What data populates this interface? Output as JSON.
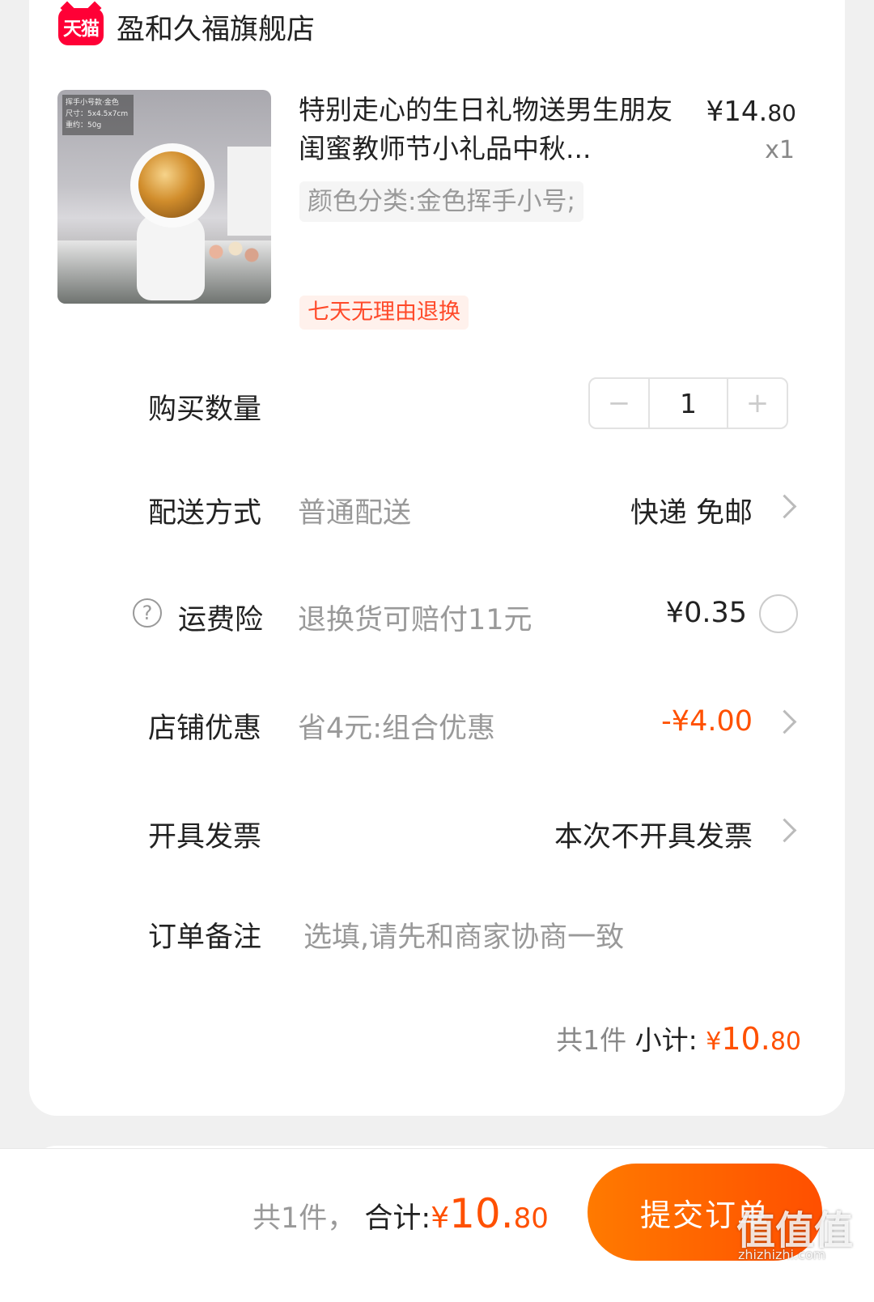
{
  "store": {
    "badge": "天猫",
    "name": "盈和久福旗舰店"
  },
  "product": {
    "image_label_lines": [
      "挥手小号款·金色",
      "尺寸：5x4.5x7cm",
      "重约：50g"
    ],
    "title": "特别走心的生日礼物送男生朋友闺蜜教师节小礼品中秋...",
    "price_main": "¥14.",
    "price_cents": "80",
    "quantity": "x1",
    "sku": "颜色分类:金色挥手小号;",
    "tag": "七天无理由退换"
  },
  "rows": {
    "qty": {
      "label": "购买数量",
      "minus": "−",
      "value": "1",
      "plus": "+"
    },
    "delivery": {
      "label": "配送方式",
      "sub": "普通配送",
      "value": "快递 免邮"
    },
    "insurance": {
      "label": "运费险",
      "sub": "退换货可赔付11元",
      "value": "¥0.35",
      "help": "?"
    },
    "discount": {
      "label": "店铺优惠",
      "sub": "省4元:组合优惠",
      "value": "-¥4.00"
    },
    "invoice": {
      "label": "开具发票",
      "value": "本次不开具发票"
    },
    "note": {
      "label": "订单备注",
      "placeholder": "选填,请先和商家协商一致"
    }
  },
  "subtotal": {
    "count": "共1件",
    "label": "小计:",
    "currency": "¥",
    "amount": "10.",
    "cents": "80"
  },
  "footer": {
    "count": "共1件，",
    "label": "合计:",
    "currency": "¥",
    "amount": "10.",
    "cents": "80",
    "submit": "提交订单"
  },
  "watermark": {
    "text": "值值值",
    "url": "zhizhizhi.com"
  },
  "colors": {
    "accent": "#ff5000",
    "tmall_red": "#ff0036"
  }
}
